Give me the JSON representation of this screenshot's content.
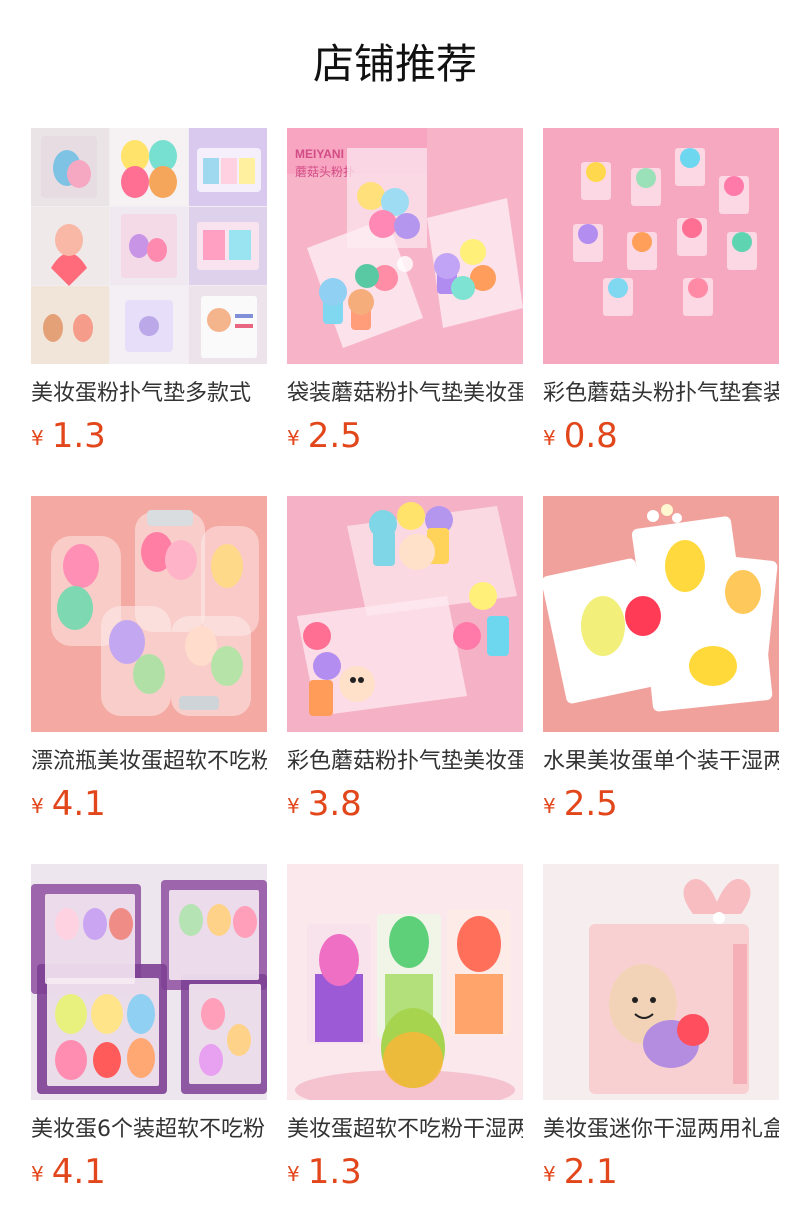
{
  "header": {
    "title": "店铺推荐"
  },
  "currency": "¥",
  "products": [
    {
      "name": "美妆蛋粉扑气垫多款式",
      "price": "1.3",
      "image": "sponge-collage-image",
      "bg": "#f2eef1"
    },
    {
      "name": "袋装蘑菇粉扑气垫美妆蛋",
      "price": "2.5",
      "image": "mushroom-puff-bags-image",
      "bg": "#f7b8cc"
    },
    {
      "name": "彩色蘑菇头粉扑气垫套装",
      "price": "0.8",
      "image": "mushroom-puff-boxes-image",
      "bg": "#f6a9c0"
    },
    {
      "name": "漂流瓶美妆蛋超软不吃粉",
      "price": "4.1",
      "image": "bottle-sponge-image",
      "bg": "#f3a7a1"
    },
    {
      "name": "彩色蘑菇粉扑气垫美妆蛋",
      "price": "3.8",
      "image": "mushroom-puff-pouch-image",
      "bg": "#f4b3c6"
    },
    {
      "name": "水果美妆蛋单个装干湿两用",
      "price": "2.5",
      "image": "fruit-sponge-card-image",
      "bg": "#f0a09a"
    },
    {
      "name": "美妆蛋6个装超软不吃粉",
      "price": "4.1",
      "image": "six-pack-sponge-image",
      "bg": "#efe7ee"
    },
    {
      "name": "美妆蛋超软不吃粉干湿两用",
      "price": "1.3",
      "image": "puff-box-sponge-image",
      "bg": "#fbe9ee"
    },
    {
      "name": "美妆蛋迷你干湿两用礼盒",
      "price": "2.1",
      "image": "mini-bow-box-image",
      "bg": "#f7efef"
    }
  ]
}
